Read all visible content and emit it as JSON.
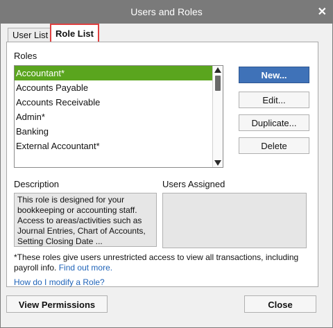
{
  "window": {
    "title": "Users and Roles",
    "close_glyph": "✕"
  },
  "tabs": [
    {
      "label": "User List"
    },
    {
      "label": "Role List"
    }
  ],
  "roles": {
    "label": "Roles",
    "items": [
      "Accountant*",
      "Accounts Payable",
      "Accounts Receivable",
      "Admin*",
      "Banking",
      "External Accountant*"
    ],
    "selected_index": 0
  },
  "buttons": {
    "new": "New...",
    "edit": "Edit...",
    "duplicate": "Duplicate...",
    "delete": "Delete"
  },
  "description": {
    "label": "Description",
    "text": "This role is designed for your bookkeeping or accounting staff. Access to areas/activities such as Journal Entries, Chart of Accounts, Setting Closing Date ..."
  },
  "users_assigned": {
    "label": "Users Assigned"
  },
  "note": {
    "text": "*These roles give users unrestricted access to view all transactions, including payroll info.",
    "find_out_more": "Find out more.",
    "how_to": "How do I modify a Role?"
  },
  "footer": {
    "view_permissions": "View Permissions",
    "close": "Close"
  },
  "colors": {
    "selected_row": "#5aa51e",
    "primary_button": "#3f72b8",
    "link": "#1f63b8",
    "highlight_border": "#e04040"
  }
}
